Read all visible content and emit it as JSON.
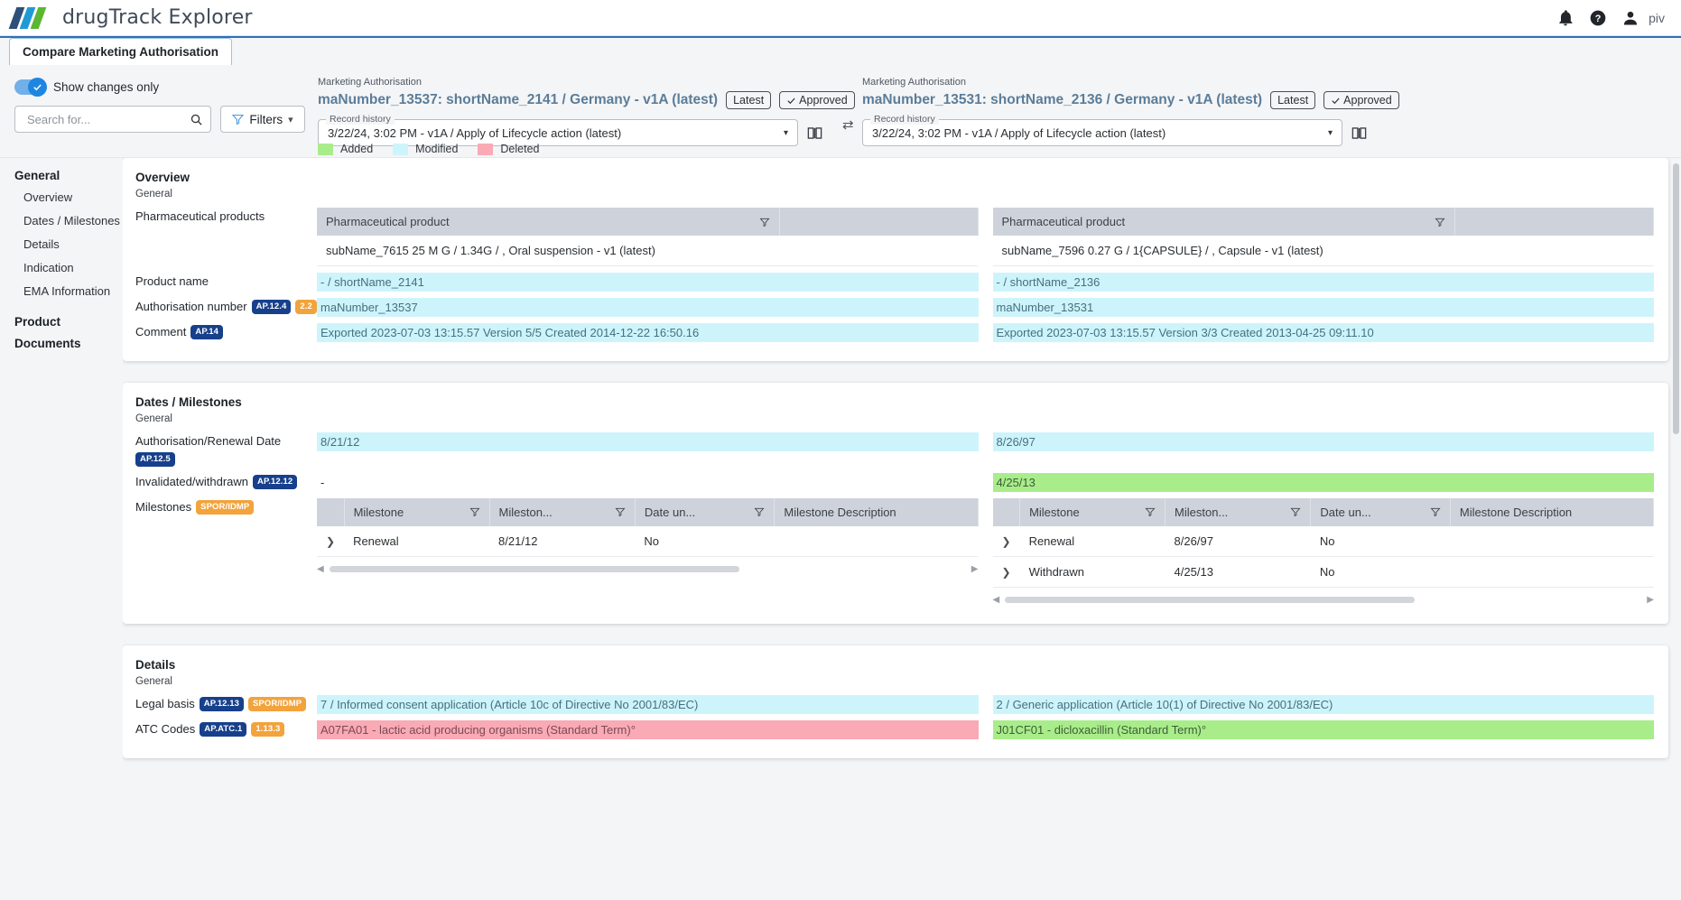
{
  "app": {
    "brand": "drugTrack Explorer",
    "username": "piv",
    "icons": {
      "bell": "bell-icon",
      "help": "help-icon",
      "user": "user-icon"
    }
  },
  "tabs": [
    {
      "label": "Compare Marketing Authorisation",
      "active": true
    }
  ],
  "controls": {
    "toggle_label": "Show changes only",
    "toggle_on": true,
    "search_placeholder": "Search for...",
    "search_value": "",
    "filters_label": "Filters"
  },
  "legend": [
    {
      "label": "Added",
      "color": "#a8ed8a"
    },
    {
      "label": "Modified",
      "color": "#cdf4fb"
    },
    {
      "label": "Deleted",
      "color": "#f9aab5"
    }
  ],
  "ma_left": {
    "kicker": "Marketing Authorisation",
    "title": "maNumber_13537: shortName_2141 / Germany - v1A (latest)",
    "pill_latest": "Latest",
    "pill_approved": "Approved",
    "record_history_legend": "Record history",
    "record_history_value": "3/22/24, 3:02 PM - v1A / Apply of Lifecycle action (latest)"
  },
  "ma_right": {
    "kicker": "Marketing Authorisation",
    "title": "maNumber_13531: shortName_2136 / Germany - v1A (latest)",
    "pill_latest": "Latest",
    "pill_approved": "Approved",
    "record_history_legend": "Record history",
    "record_history_value": "3/22/24, 3:02 PM - v1A / Apply of Lifecycle action (latest)"
  },
  "sidebar": {
    "groups": [
      {
        "label": "General",
        "items": [
          {
            "label": "Overview"
          },
          {
            "label": "Dates / Milestones"
          },
          {
            "label": "Details"
          },
          {
            "label": "Indication"
          },
          {
            "label": "EMA Information"
          }
        ]
      },
      {
        "label": "Product",
        "items": []
      },
      {
        "label": "Documents",
        "items": []
      }
    ]
  },
  "overview": {
    "title": "Overview",
    "subtitle": "General",
    "products_label": "Pharmaceutical products",
    "product_table_header": "Pharmaceutical product",
    "product_left": "subName_7615 25 M G / 1.34G / , Oral suspension - v1 (latest)",
    "product_right": "subName_7596 0.27 G / 1{CAPSULE} / , Capsule - v1 (latest)",
    "rows": [
      {
        "label": "Product name",
        "badges": [],
        "left": "- / shortName_2141",
        "left_state": "mod",
        "right": "- / shortName_2136",
        "right_state": "mod"
      },
      {
        "label": "Authorisation number",
        "badges": [
          {
            "text": "AP.12.4",
            "kind": "navy"
          },
          {
            "text": "2.2",
            "kind": "amber"
          }
        ],
        "left": "maNumber_13537",
        "left_state": "mod",
        "right": "maNumber_13531",
        "right_state": "mod"
      },
      {
        "label": "Comment",
        "badges": [
          {
            "text": "AP.14",
            "kind": "navy"
          }
        ],
        "left": "Exported 2023-07-03 13:15.57 Version 5/5 Created 2014-12-22 16:50.16",
        "left_state": "mod",
        "right": "Exported 2023-07-03 13:15.57 Version 3/3 Created 2013-04-25 09:11.10",
        "right_state": "mod"
      }
    ]
  },
  "dates": {
    "title": "Dates / Milestones",
    "subtitle": "General",
    "rows": [
      {
        "label": "Authorisation/Renewal Date",
        "badges": [
          {
            "text": "AP.12.5",
            "kind": "navy"
          }
        ],
        "left": "8/21/12",
        "left_state": "mod",
        "right": "8/26/97",
        "right_state": "mod"
      },
      {
        "label": "Invalidated/withdrawn",
        "badges": [
          {
            "text": "AP.12.12",
            "kind": "navy"
          }
        ],
        "left": "-",
        "left_state": "plain",
        "right": "4/25/13",
        "right_state": "add"
      }
    ],
    "milestones_label": "Milestones",
    "milestones_badges": [
      {
        "text": "SPOR/IDMP",
        "kind": "amber"
      }
    ],
    "milestone_columns": [
      "Milestone",
      "Mileston...",
      "Date un...",
      "Milestone Description"
    ],
    "milestones_left": [
      {
        "name": "Renewal",
        "date": "8/21/12",
        "unknown": "No",
        "description": ""
      }
    ],
    "milestones_right": [
      {
        "name": "Renewal",
        "date": "8/26/97",
        "unknown": "No",
        "description": ""
      },
      {
        "name": "Withdrawn",
        "date": "4/25/13",
        "unknown": "No",
        "description": ""
      }
    ]
  },
  "details": {
    "title": "Details",
    "subtitle": "General",
    "rows": [
      {
        "label": "Legal basis",
        "badges": [
          {
            "text": "AP.12.13",
            "kind": "navy"
          },
          {
            "text": "SPOR/IDMP",
            "kind": "amber"
          }
        ],
        "left": "7 / Informed consent application (Article 10c of Directive No 2001/83/EC)",
        "left_state": "mod",
        "right": "2 / Generic application (Article 10(1) of Directive No 2001/83/EC)",
        "right_state": "mod"
      },
      {
        "label": "ATC Codes",
        "badges": [
          {
            "text": "AP.ATC.1",
            "kind": "navy"
          },
          {
            "text": "1.13.3",
            "kind": "amber"
          }
        ],
        "left": "A07FA01 - lactic acid producing organisms (Standard Term)°",
        "left_state": "del",
        "right": "J01CF01 - dicloxacillin (Standard Term)°",
        "right_state": "add"
      }
    ]
  }
}
